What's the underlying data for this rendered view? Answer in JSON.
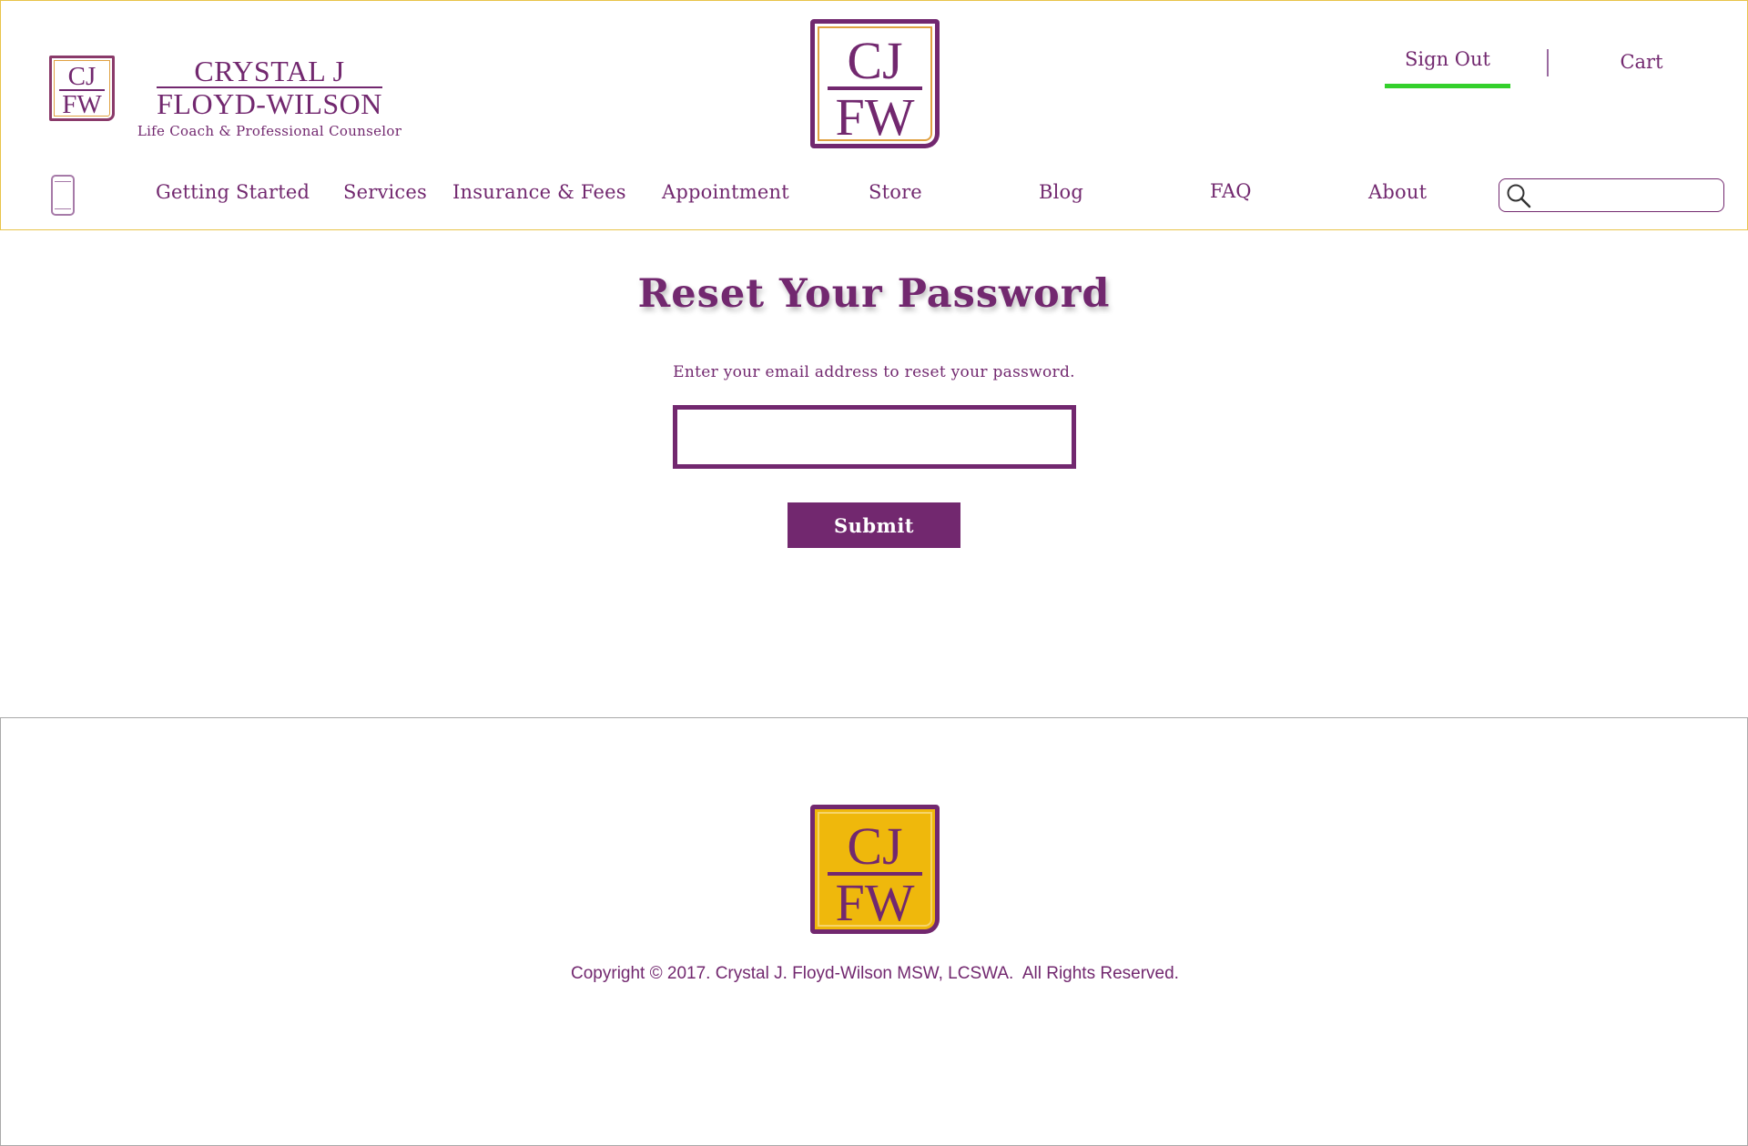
{
  "header": {
    "logo_small": {
      "top": "CJ",
      "bottom": "FW"
    },
    "brand": {
      "name_line1": "CRYSTAL J",
      "name_line2": "FLOYD-WILSON",
      "tagline": "Life Coach & Professional Counselor"
    },
    "logo_center": {
      "top": "CJ",
      "bottom": "FW"
    },
    "signout_label": "Sign Out",
    "cart_label": "Cart",
    "colors": {
      "accent": "#72286f",
      "active_underline": "#34d02c",
      "border": "#e8c44a"
    }
  },
  "nav": {
    "items": [
      {
        "label": "Getting Started"
      },
      {
        "label": "Services"
      },
      {
        "label": "Insurance & Fees"
      },
      {
        "label": "Appointment"
      },
      {
        "label": "Store"
      },
      {
        "label": "Blog"
      },
      {
        "label": "FAQ"
      },
      {
        "label": "About"
      }
    ],
    "search": {
      "value": "",
      "placeholder": "",
      "icon": "search-icon"
    },
    "mobile_icon": "mobile-phone-icon"
  },
  "main": {
    "title": "Reset Your Password",
    "instructions": "Enter your email address to reset your password.",
    "email": {
      "value": "",
      "placeholder": ""
    },
    "submit_label": "Submit"
  },
  "footer": {
    "logo": {
      "top": "CJ",
      "bottom": "FW"
    },
    "copyright": "Copyright © 2017. Crystal J. Floyd-Wilson MSW, LCSWA.  All Rights Reserved.",
    "colors": {
      "logo_bg": "#efb80c"
    }
  }
}
